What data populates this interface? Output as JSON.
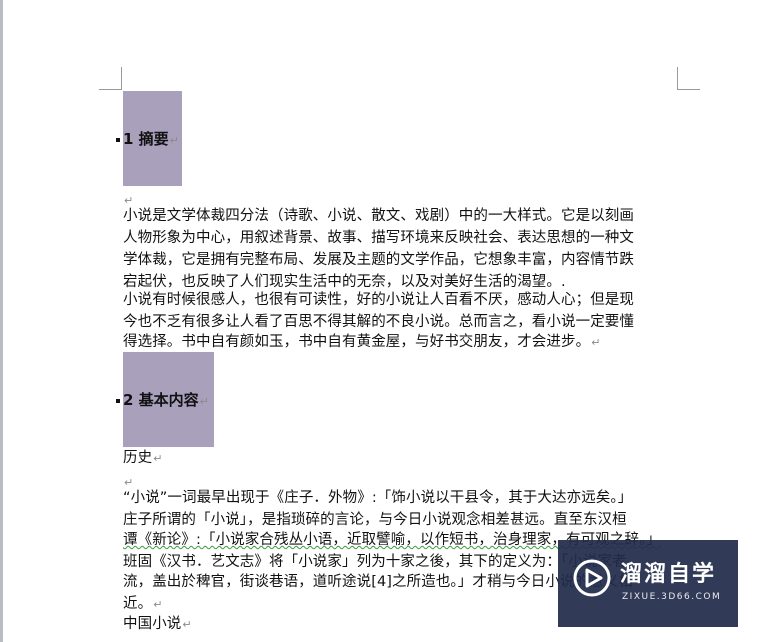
{
  "headings": {
    "h1": "1 摘要",
    "h2": "2 基本内容"
  },
  "para_mark": "↵",
  "body": {
    "l1": "小说是文学体裁四分法（诗歌、小说、散文、戏剧）中的一大样式。它是以刻画",
    "l2": "人物形象为中心，用叙述背景、故事、描写环境来反映社会、表达思想的一种文",
    "l3": "学体裁，它是拥有完整布局、发展及主题的文学作品，它想象丰富，内容情节跌",
    "l4": "宕起伏，也反映了人们现实生活中的无奈，以及对美好生活的渴望。.",
    "l5": "小说有时候很感人，也很有可读性，好的小说让人百看不厌，感动人心；但是现",
    "l6": "今也不乏有很多让人看了百思不得其解的不良小说。总而言之，看小说一定要懂",
    "l7": "得选择。书中自有颜如玉，书中自有黄金屋，与好书交朋友，才会进步。",
    "l8": "历史",
    "l9": "“小说”一词最早出现于《庄子．外物》:「饰小说以干县令，其于大达亦远矣。」",
    "l10": "庄子所谓的「小说」，是指琐碎的言论，与今日小说观念相差甚远。直至东汉桓",
    "l11": "谭《新论》:「小说家合残丛小语，近取譬喻，以作短书，治身理家，有可观之辞。」",
    "l12": "班固《汉书．艺文志》将「小说家」列为十家之後，其下的定义为：「小说家者",
    "l13": "流，盖出於稗官，街谈巷语，道听途说[4]之所造也。」才稍与今日小说的意义相",
    "l14": "近。",
    "l15": "中国小说"
  },
  "watermark": {
    "title": "溜溜自学",
    "subtitle": "ZIXUE.3D66.COM"
  }
}
